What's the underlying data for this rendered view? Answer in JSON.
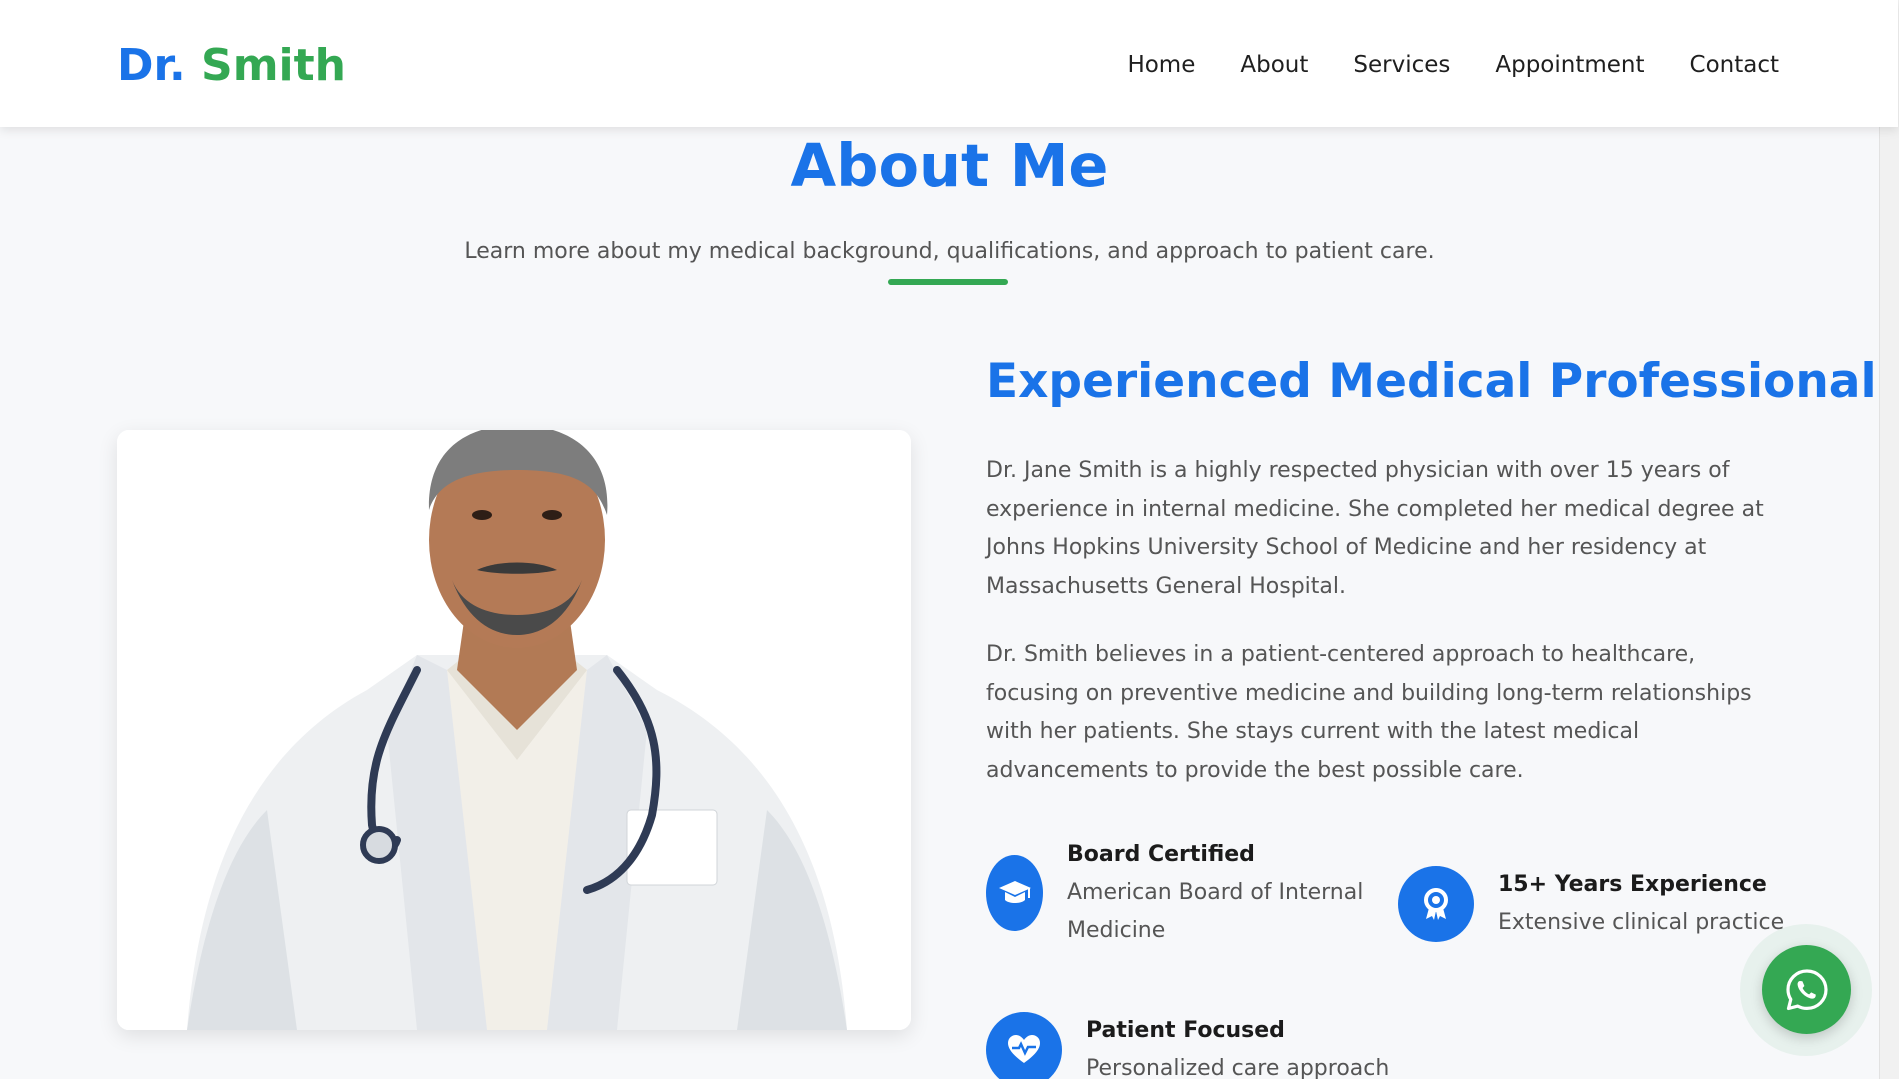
{
  "header": {
    "logo_dr": "Dr.",
    "logo_name": "Smith",
    "nav": [
      "Home",
      "About",
      "Services",
      "Appointment",
      "Contact"
    ]
  },
  "about": {
    "title": "About Me",
    "subtitle": "Learn more about my medical background, qualifications, and approach to patient care.",
    "heading": "Experienced Medical Professional",
    "paragraphs": [
      "Dr. Jane Smith is a highly respected physician with over 15 years of experience in internal medicine. She completed her medical degree at Johns Hopkins University School of Medicine and her residency at Massachusetts General Hospital.",
      "Dr. Smith believes in a patient-centered approach to healthcare, focusing on preventive medicine and building long-term relationships with her patients. She stays current with the latest medical advancements to provide the best possible care."
    ],
    "features": [
      {
        "title": "Board Certified",
        "desc": "American Board of Internal Medicine",
        "icon": "graduation-cap-icon"
      },
      {
        "title": "15+ Years Experience",
        "desc": "Extensive clinical practice",
        "icon": "award-icon"
      },
      {
        "title": "Patient Focused",
        "desc": "Personalized care approach",
        "icon": "heart-pulse-icon"
      }
    ]
  },
  "photo": {
    "icon": "doctor-photo"
  },
  "whatsapp": {
    "icon": "whatsapp-icon"
  },
  "colors": {
    "primary": "#1a73e8",
    "accent": "#34a853",
    "background": "#f7f8fa"
  }
}
